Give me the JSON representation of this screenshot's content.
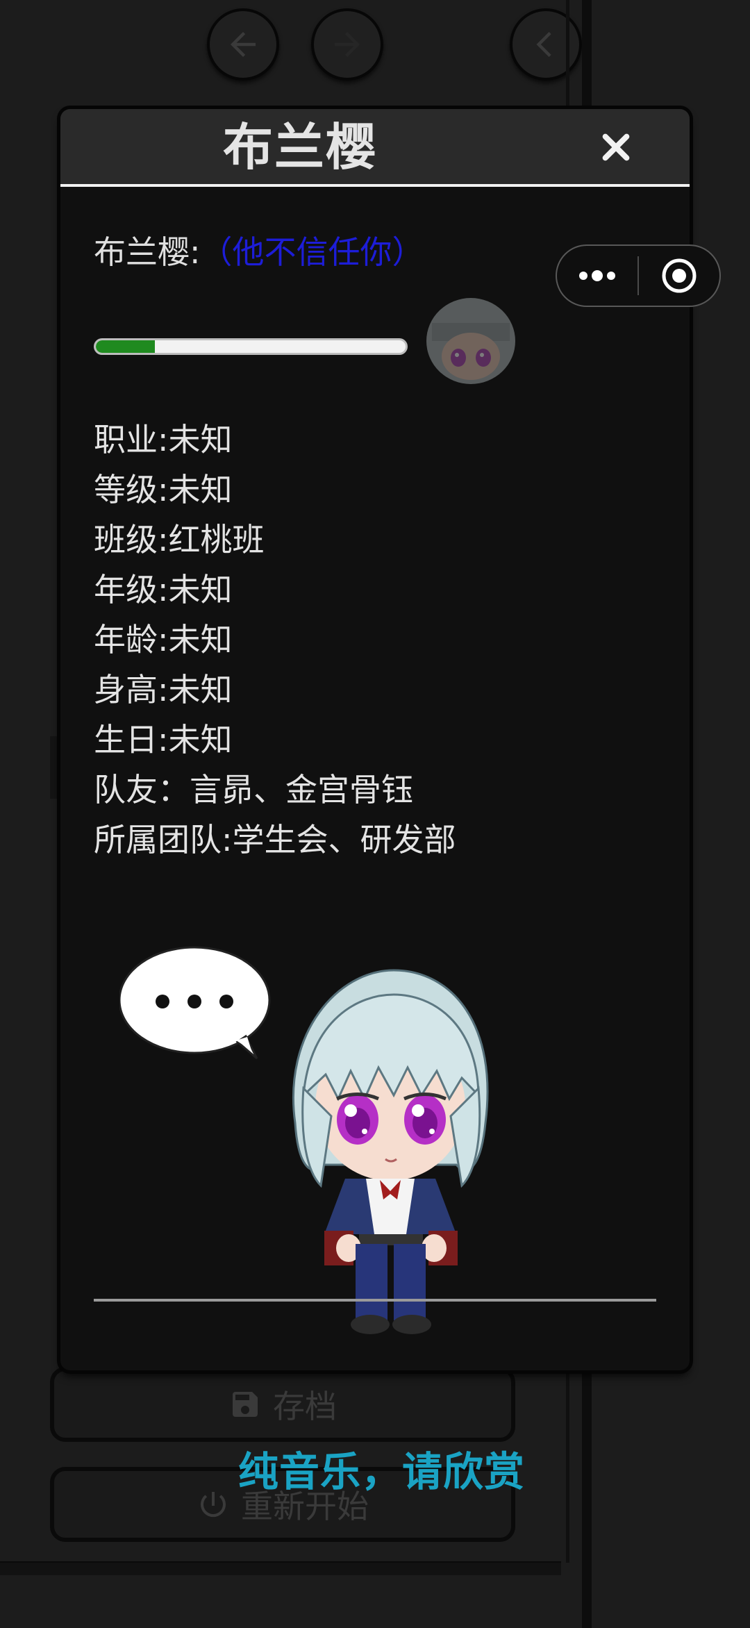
{
  "background": {
    "nav_buttons": [
      {
        "icon": "arrow-left-icon"
      },
      {
        "icon": "arrow-right-icon"
      },
      {
        "icon": "chevron-left-icon"
      }
    ],
    "save_button": {
      "label": "存档",
      "icon": "floppy-disk-icon"
    },
    "restart_button": {
      "label": "重新开始",
      "icon": "power-icon"
    }
  },
  "capsule": {
    "more_icon": "more-dots-icon",
    "close_icon": "target-circle-icon"
  },
  "modal": {
    "title": "布兰樱",
    "close_icon": "close-x-icon",
    "trust": {
      "name_prefix": "布兰樱:",
      "status": "（他不信任你）",
      "status_color": "#1d1dd8"
    },
    "affinity_progress": 0.19,
    "progress_color": "#1f8a1f",
    "info": [
      "职业:未知",
      "等级:未知",
      "班级:红桃班",
      "年级:未知",
      "年龄:未知",
      "身高:未知",
      "生日:未知",
      "队友：言昴、金宫骨钰",
      "所属团队:学生会、研发部"
    ],
    "speech_bubble": "..."
  },
  "caption": {
    "text": "纯音乐，请欣赏",
    "color": "#1aa3c4"
  }
}
